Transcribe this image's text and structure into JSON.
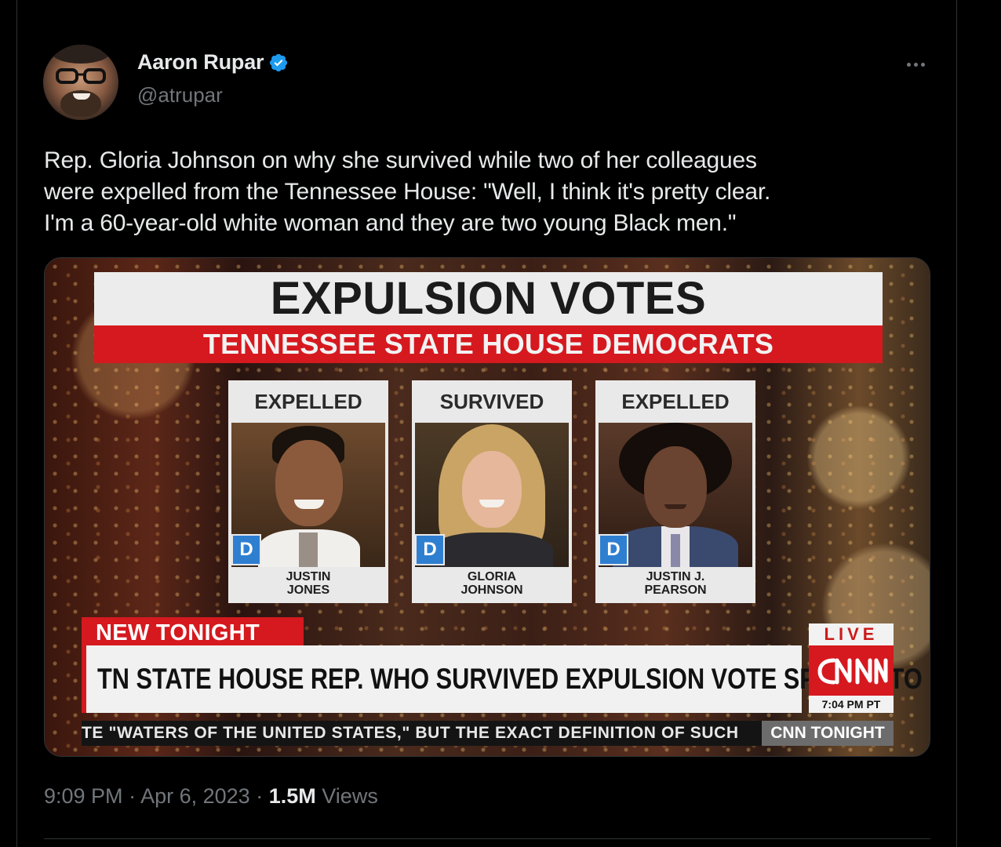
{
  "author": {
    "display_name": "Aaron Rupar",
    "handle": "@atrupar",
    "verified": true
  },
  "tweet": {
    "text_lines": [
      "Rep. Gloria Johnson on why she survived while two of her colleagues",
      "were expelled from the Tennessee House: \"Well, I think it's pretty clear.",
      "I'm a 60-year-old white woman and they are two young Black men.\""
    ]
  },
  "media": {
    "headline": "EXPULSION VOTES",
    "subheadline": "TENNESSEE STATE HOUSE DEMOCRATS",
    "cards": [
      {
        "status": "EXPELLED",
        "party": "D",
        "name_line1": "JUSTIN",
        "name_line2": "JONES"
      },
      {
        "status": "SURVIVED",
        "party": "D",
        "name_line1": "GLORIA",
        "name_line2": "JOHNSON"
      },
      {
        "status": "EXPELLED",
        "party": "D",
        "name_line1": "JUSTIN J.",
        "name_line2": "PEARSON"
      }
    ],
    "new_tonight": "NEW TONIGHT",
    "chyron": "TN STATE HOUSE REP. WHO SURVIVED EXPULSION VOTE SPEAKS TO CNN",
    "live": "LIVE",
    "clock": "7:04 PM PT",
    "ticker": "TE \"WATERS OF THE UNITED STATES,\" BUT THE EXACT DEFINITION OF SUCH",
    "show_tag": "CNN TONIGHT",
    "colors": {
      "cnn_red": "#d5191f",
      "party_blue": "#2f7fd1"
    }
  },
  "meta": {
    "time": "9:09 PM",
    "separator": "·",
    "date": "Apr 6, 2023",
    "views_count": "1.5M",
    "views_label": "Views"
  },
  "icons": {
    "verified": "verified-badge-icon",
    "more": "more-options-icon"
  },
  "theme": {
    "background": "#000000",
    "text": "#e7e9ea",
    "muted": "#71767b",
    "verified_blue": "#1d9bf0"
  }
}
